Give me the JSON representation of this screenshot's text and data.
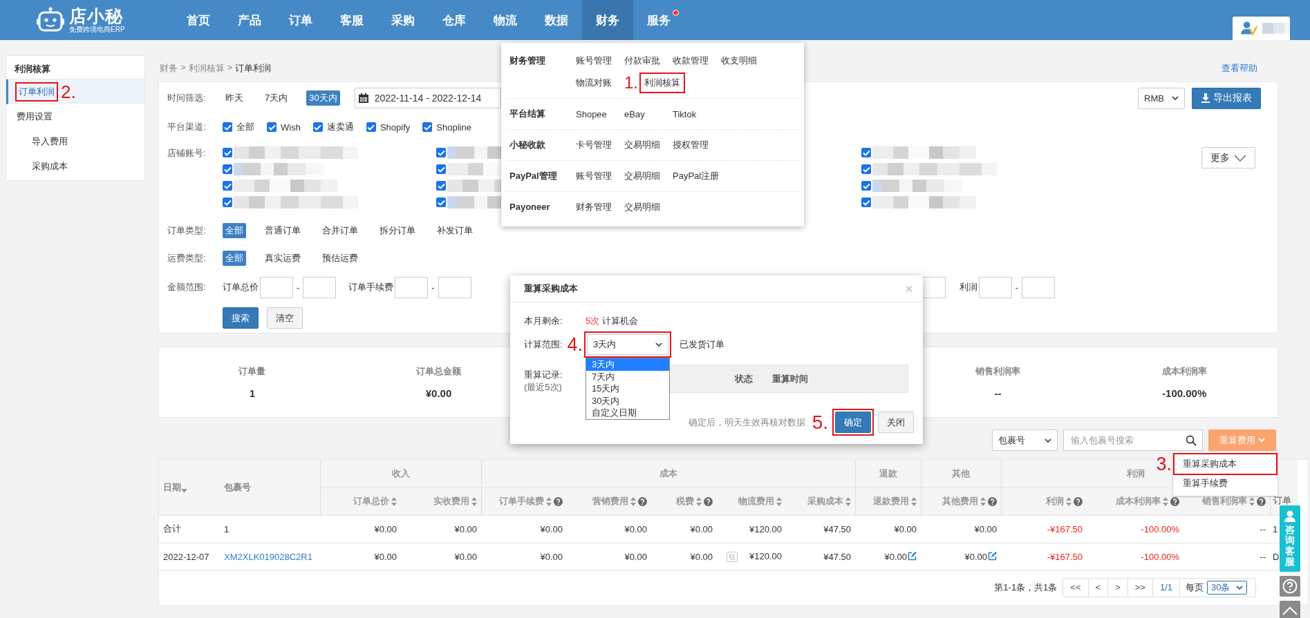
{
  "header": {
    "logo": {
      "name": "店小秘",
      "tagline": "免费跨境电商ERP"
    },
    "nav": [
      {
        "label": "首页",
        "selected": false,
        "notification": false
      },
      {
        "label": "产品",
        "selected": false,
        "notification": false
      },
      {
        "label": "订单",
        "selected": false,
        "notification": false
      },
      {
        "label": "客服",
        "selected": false,
        "notification": false
      },
      {
        "label": "采购",
        "selected": false,
        "notification": false
      },
      {
        "label": "仓库",
        "selected": false,
        "notification": false
      },
      {
        "label": "物流",
        "selected": false,
        "notification": false
      },
      {
        "label": "数据",
        "selected": false,
        "notification": false
      },
      {
        "label": "财务",
        "selected": true,
        "notification": false
      },
      {
        "label": "服务",
        "selected": false,
        "notification": true
      }
    ]
  },
  "finance_menu": {
    "sections": [
      {
        "title": "财务管理",
        "items": [
          {
            "label": "账号管理",
            "highlighted": false
          },
          {
            "label": "付款审批",
            "highlighted": false
          },
          {
            "label": "收款管理",
            "highlighted": false
          },
          {
            "label": "收支明细",
            "highlighted": false
          },
          {
            "label": "物流对账",
            "highlighted": false
          },
          {
            "label": "利润核算",
            "highlighted": true,
            "annotation": "1."
          }
        ]
      },
      {
        "title": "平台结算",
        "items": [
          {
            "label": "Shopee",
            "highlighted": false
          },
          {
            "label": "eBay",
            "highlighted": false
          },
          {
            "label": "Tiktok",
            "highlighted": false
          }
        ]
      },
      {
        "title": "小秘收款",
        "items": [
          {
            "label": "卡号管理",
            "highlighted": false
          },
          {
            "label": "交易明细",
            "highlighted": false
          },
          {
            "label": "授权管理",
            "highlighted": false
          }
        ]
      },
      {
        "title": "PayPal管理",
        "items": [
          {
            "label": "账号管理",
            "highlighted": false
          },
          {
            "label": "交易明细",
            "highlighted": false
          },
          {
            "label": "PayPal注册",
            "highlighted": false
          }
        ]
      },
      {
        "title": "Payoneer",
        "items": [
          {
            "label": "财务管理",
            "highlighted": false
          },
          {
            "label": "交易明细",
            "highlighted": false
          }
        ]
      }
    ]
  },
  "sidebar": {
    "title": "利润核算",
    "items": [
      {
        "label": "订单利润",
        "selected": true,
        "highlighted": true,
        "annotation": "2."
      },
      {
        "label": "费用设置",
        "selected": false,
        "highlighted": false,
        "children": [
          {
            "label": "导入费用",
            "selected": false,
            "highlighted": false
          },
          {
            "label": "采购成本",
            "selected": false,
            "highlighted": false
          }
        ]
      }
    ]
  },
  "breadcrumb": {
    "separator": ">",
    "items": [
      "财务",
      "利润核算",
      "订单利润"
    ]
  },
  "help_link": "查看帮助",
  "filters": {
    "time": {
      "label": "时间筛选:",
      "options": [
        {
          "label": "昨天",
          "selected": false
        },
        {
          "label": "7天内",
          "selected": false
        },
        {
          "label": "30天内",
          "selected": true
        }
      ],
      "date_range": "2022-11-14 - 2022-12-14"
    },
    "currency": "RMB",
    "export_button": "导出报表",
    "platform": {
      "label": "平台渠道:",
      "options": [
        {
          "label": "全部",
          "checked": true
        },
        {
          "label": "Wish",
          "checked": true
        },
        {
          "label": "速卖通",
          "checked": true
        },
        {
          "label": "Shopify",
          "checked": true
        },
        {
          "label": "Shopline",
          "checked": true
        }
      ]
    },
    "stores": {
      "label": "店铺账号:",
      "more_button": "更多",
      "columns": [
        [
          {
            "checked": true
          },
          {
            "checked": true
          },
          {
            "checked": true
          },
          {
            "checked": true
          }
        ],
        [
          {
            "checked": true
          },
          {
            "checked": true
          },
          {
            "checked": true
          },
          {
            "checked": true
          }
        ],
        [
          {
            "checked": true
          },
          {
            "checked": true
          },
          {
            "checked": true
          },
          {
            "checked": true
          }
        ]
      ]
    },
    "order_type": {
      "label": "订单类型:",
      "options": [
        {
          "label": "全部",
          "selected": true
        },
        {
          "label": "普通订单",
          "selected": false
        },
        {
          "label": "合并订单",
          "selected": false
        },
        {
          "label": "拆分订单",
          "selected": false
        },
        {
          "label": "补发订单",
          "selected": false
        }
      ]
    },
    "shipping_type": {
      "label": "运费类型:",
      "options": [
        {
          "label": "全部",
          "selected": true
        },
        {
          "label": "真实运费",
          "selected": false
        },
        {
          "label": "预估运费",
          "selected": false
        }
      ]
    },
    "amount": {
      "label": "金额范围:",
      "ranges": [
        {
          "kind": "range",
          "label": "订单总价",
          "separator": "-"
        },
        {
          "kind": "range",
          "label": "订单手续费",
          "separator": "-"
        },
        {
          "kind": "input"
        },
        {
          "kind": "range",
          "label": "利润",
          "separator": "-"
        }
      ]
    },
    "search_button": "搜索",
    "clear_button": "清空"
  },
  "stats": [
    {
      "label": "订单量",
      "value": "1"
    },
    {
      "label": "订单总金额",
      "value": "¥0.00"
    },
    {
      "label": "销售利润率",
      "value": "--"
    },
    {
      "label": "成本利润率",
      "value": "-100.00%"
    }
  ],
  "toolbar": {
    "search_type": "包裹号",
    "search_placeholder": "输入包裹号搜索",
    "recalc_button": "重算费用"
  },
  "recalc_menu": {
    "items": [
      {
        "label": "重算采购成本",
        "highlighted": true,
        "annotation": "3."
      },
      {
        "label": "重算手续费",
        "highlighted": false
      }
    ]
  },
  "table": {
    "column_groups": [
      {
        "label": "收入"
      },
      {
        "label": "成本"
      },
      {
        "label": "退款"
      },
      {
        "label": "其他"
      },
      {
        "label": "利润"
      }
    ],
    "columns": [
      {
        "label": "日期",
        "grouped": false,
        "sortable": false,
        "sorted": true,
        "help": false
      },
      {
        "label": "包裹号",
        "grouped": false,
        "sortable": false,
        "sorted": false,
        "help": false
      },
      {
        "label": "订单总价",
        "group_start": true,
        "grouped": true,
        "sortable": true,
        "sorted": false,
        "help": false
      },
      {
        "label": "实收费用",
        "grouped": true,
        "sortable": true,
        "sorted": false,
        "help": false
      },
      {
        "label": "订单手续费",
        "group_start": true,
        "grouped": true,
        "sortable": true,
        "sorted": false,
        "help": true
      },
      {
        "label": "营销费用",
        "grouped": true,
        "sortable": true,
        "sorted": false,
        "help": true
      },
      {
        "label": "税费",
        "grouped": true,
        "sortable": true,
        "sorted": false,
        "help": true
      },
      {
        "label": "物流费用",
        "grouped": true,
        "sortable": true,
        "sorted": false,
        "help": false
      },
      {
        "label": "采购成本",
        "grouped": true,
        "sortable": true,
        "sorted": false,
        "help": false
      },
      {
        "label": "退款费用",
        "group_start": true,
        "grouped": true,
        "sortable": true,
        "sorted": false,
        "help": false
      },
      {
        "label": "其他费用",
        "group_start": true,
        "grouped": true,
        "sortable": true,
        "sorted": false,
        "help": true
      },
      {
        "label": "利润",
        "group_start": true,
        "grouped": true,
        "sortable": true,
        "sorted": false,
        "help": true
      },
      {
        "label": "成本利润率",
        "grouped": true,
        "sortable": true,
        "sorted": false,
        "help": true
      },
      {
        "label": "销售利润率",
        "grouped": true,
        "sortable": true,
        "sorted": false,
        "help": true
      },
      {
        "label": "订单",
        "grouped": false,
        "sortable": false,
        "sorted": false,
        "help": false
      }
    ],
    "rows": [
      {
        "cells": [
          {
            "kind": "plain",
            "text": "合计"
          },
          {
            "kind": "plain",
            "text": "1"
          },
          {
            "kind": "plain",
            "text": "¥0.00"
          },
          {
            "kind": "plain",
            "text": "¥0.00"
          },
          {
            "kind": "plain",
            "text": "¥0.00"
          },
          {
            "kind": "plain",
            "text": "¥0.00"
          },
          {
            "kind": "plain",
            "text": "¥0.00"
          },
          {
            "kind": "plain",
            "text": "¥120.00"
          },
          {
            "kind": "plain",
            "text": "¥47.50"
          },
          {
            "kind": "plain",
            "text": "¥0.00"
          },
          {
            "kind": "plain",
            "text": "¥0.00"
          },
          {
            "kind": "negative",
            "text": "-¥167.50"
          },
          {
            "kind": "negative",
            "text": "-100.00%"
          },
          {
            "kind": "plain",
            "text": "--"
          },
          {
            "kind": "plain",
            "text": "1"
          }
        ]
      },
      {
        "cells": [
          {
            "kind": "plain",
            "text": "2022-12-07"
          },
          {
            "kind": "link",
            "text": "XM2XLK019028C2R1"
          },
          {
            "kind": "plain",
            "text": "¥0.00"
          },
          {
            "kind": "plain",
            "text": "¥0.00"
          },
          {
            "kind": "plain",
            "text": "¥0.00"
          },
          {
            "kind": "plain",
            "text": "¥0.00"
          },
          {
            "kind": "plain",
            "text": "¥0.00"
          },
          {
            "kind": "badge",
            "badge": "估",
            "text": "¥120.00"
          },
          {
            "kind": "plain",
            "text": "¥47.50"
          },
          {
            "kind": "editable",
            "text": "¥0.00"
          },
          {
            "kind": "editable",
            "text": "¥0.00"
          },
          {
            "kind": "negative",
            "text": "-¥167.50"
          },
          {
            "kind": "negative",
            "text": "-100.00%"
          },
          {
            "kind": "plain",
            "text": "--"
          },
          {
            "kind": "plain",
            "text": "D"
          }
        ]
      }
    ]
  },
  "pagination": {
    "summary": "第1-1条，共1条",
    "buttons": [
      "<<",
      "<",
      ">",
      ">>"
    ],
    "page": "1/1",
    "per_page_label": "每页",
    "per_page": "30条"
  },
  "dialog": {
    "title": "重算采购成本",
    "close": "×",
    "remaining_label": "本月剩余:",
    "remaining_count": "5次",
    "remaining_suffix": "计算机会",
    "range_label": "计算范围:",
    "range_value": "3天内",
    "range_highlighted": true,
    "range_annotation": "4.",
    "range_note": "已发货订单",
    "range_options": [
      {
        "label": "3天内",
        "selected": true
      },
      {
        "label": "7天内",
        "selected": false
      },
      {
        "label": "15天内",
        "selected": false
      },
      {
        "label": "30天内",
        "selected": false
      },
      {
        "label": "自定义日期",
        "selected": false
      }
    ],
    "history_label": "重算记录:",
    "history_sublabel": "(最近5次)",
    "history_columns": [
      "状态",
      "重算时间"
    ],
    "footer_note": "确定后，明天生效再核对数据",
    "confirm_button": "确定",
    "confirm_highlighted": true,
    "confirm_annotation": "5.",
    "close_button": "关闭"
  },
  "float_tools": {
    "support": "咨询客服"
  }
}
